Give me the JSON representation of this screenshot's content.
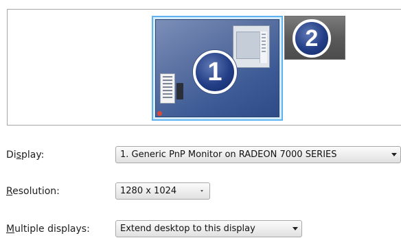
{
  "monitors": {
    "primary_number": "1",
    "secondary_number": "2"
  },
  "settings": {
    "display": {
      "label_prefix": "Di",
      "label_accel": "s",
      "label_suffix": "play:",
      "value": "1. Generic PnP Monitor on RADEON 7000 SERIES"
    },
    "resolution": {
      "label_accel": "R",
      "label_suffix": "esolution:",
      "value": "1280 x 1024"
    },
    "multiple_displays": {
      "label_accel": "M",
      "label_suffix": "ultiple displays:",
      "value": "Extend desktop to this display"
    }
  },
  "colors": {
    "selection_border": "#5fb2f0",
    "desktop_blue": "#3c5a95",
    "badge_blue": "#233e86"
  },
  "icons": [
    "dropdown-arrow-icon",
    "windows-start-orb-icon"
  ]
}
